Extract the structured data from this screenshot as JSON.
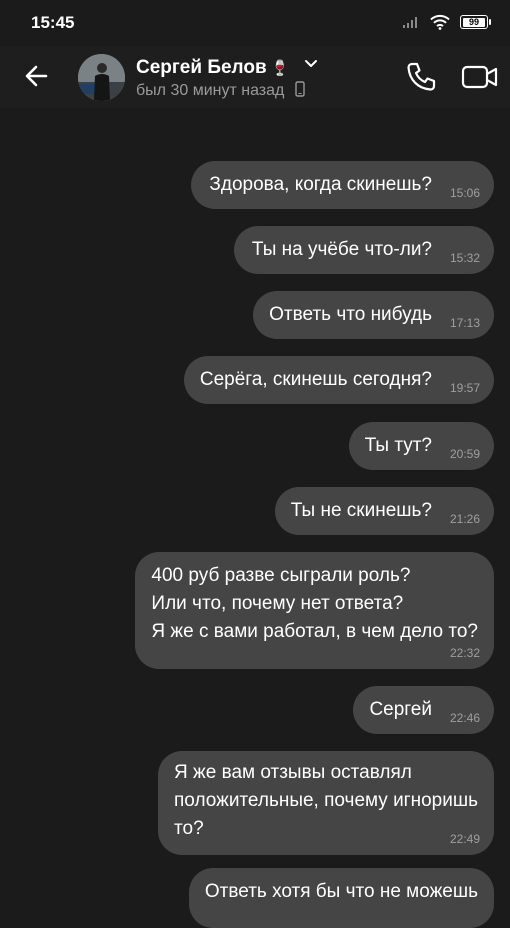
{
  "status_bar": {
    "time": "15:45",
    "battery": "99"
  },
  "header": {
    "name": "Сергей Белов",
    "name_emoji": "🍷",
    "status": "был 30 минут назад"
  },
  "messages": [
    {
      "text": "Здорова, когда скинешь?",
      "time": "15:06"
    },
    {
      "text": "Ты на учёбе что-ли?",
      "time": "15:32"
    },
    {
      "text": "Ответь что нибудь",
      "time": "17:13"
    },
    {
      "text": "Серёга, скинешь сегодня?",
      "time": "19:57"
    },
    {
      "text": "Ты тут?",
      "time": "20:59"
    },
    {
      "text": "Ты не скинешь?",
      "time": "21:26"
    },
    {
      "lines": [
        "400 руб разве сыграли роль?",
        "Или что, почему нет ответа?",
        "Я же с вами работал, в чем дело то?"
      ],
      "time": "22:32"
    },
    {
      "text": "Сергей",
      "time": "22:46"
    },
    {
      "lines": [
        "Я же вам отзывы оставлял",
        "положительные, почему игноришь",
        "то?"
      ],
      "time": "22:49"
    },
    {
      "text": "Ответь хотя бы что не можешь"
    }
  ]
}
